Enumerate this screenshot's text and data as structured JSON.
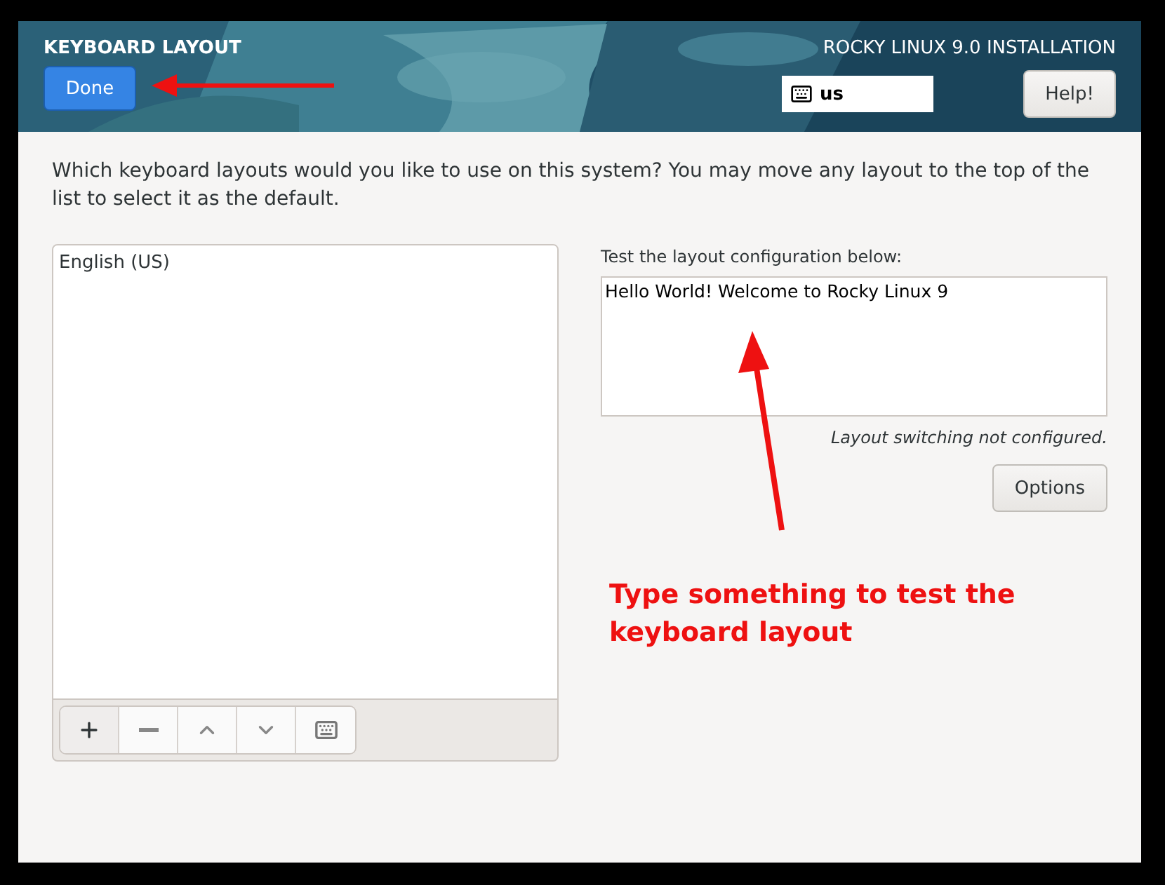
{
  "header": {
    "title": "KEYBOARD LAYOUT",
    "done_button": "Done",
    "product": "ROCKY LINUX 9.0 INSTALLATION",
    "layout_indicator": "us",
    "help_button": "Help!"
  },
  "instructions": "Which keyboard layouts would you like to use on this system?  You may move any layout to the top of the list to select it as the default.",
  "layouts": [
    {
      "name": "English (US)",
      "selected": false
    }
  ],
  "toolbar": [
    {
      "kind": "add"
    },
    {
      "kind": "remove"
    },
    {
      "kind": "up"
    },
    {
      "kind": "down"
    },
    {
      "kind": "preview"
    }
  ],
  "test": {
    "label": "Test the layout configuration below:",
    "value": "Hello World! Welcome to Rocky Linux 9",
    "note": "Layout switching not configured.",
    "options_button": "Options"
  },
  "annotation": "Type something to test the keyboard layout"
}
